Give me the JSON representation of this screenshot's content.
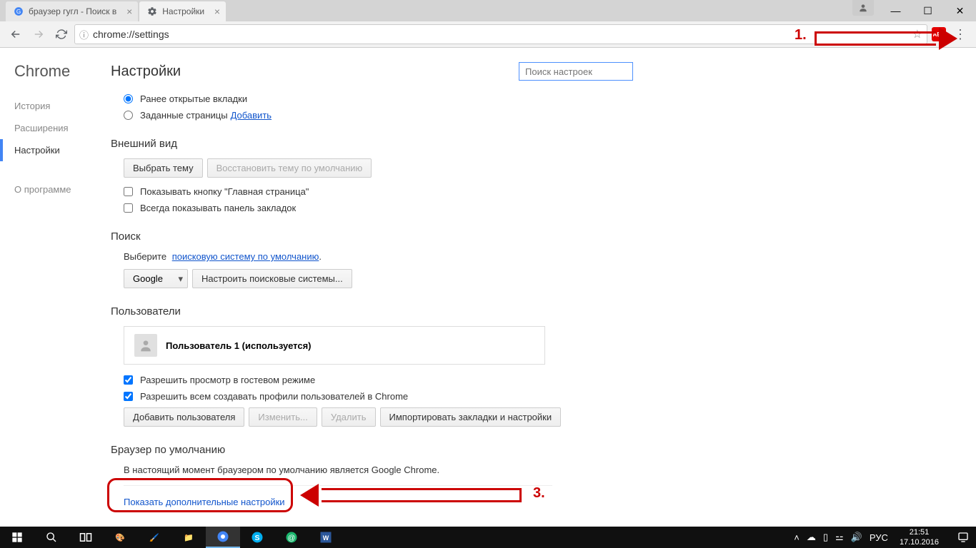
{
  "browser": {
    "tabs": [
      {
        "title": "браузер гугл - Поиск в ",
        "active": false
      },
      {
        "title": "Настройки",
        "active": true
      }
    ],
    "url": "chrome://settings",
    "ext_abp": "ABP"
  },
  "annotations": {
    "label1": "1.",
    "label3": "3."
  },
  "sidenav": {
    "logo": "Chrome",
    "history": "История",
    "extensions": "Расширения",
    "settings": "Настройки",
    "about": "О программе"
  },
  "settings": {
    "title": "Настройки",
    "search_placeholder": "Поиск настроек",
    "startup": {
      "radio_prev": "Ранее открытые вкладки",
      "radio_custom": "Заданные страницы",
      "add_link": "Добавить"
    },
    "appearance": {
      "heading": "Внешний вид",
      "choose_theme": "Выбрать тему",
      "reset_theme": "Восстановить тему по умолчанию",
      "show_home": "Показывать кнопку \"Главная страница\"",
      "show_bookmarks": "Всегда показывать панель закладок"
    },
    "search": {
      "heading": "Поиск",
      "help1": "Выберите ",
      "help_link": "поисковую систему по умолчанию",
      "engine": "Google",
      "manage": "Настроить поисковые системы..."
    },
    "users": {
      "heading": "Пользователи",
      "user1": "Пользователь 1 (используется)",
      "guest": "Разрешить просмотр в гостевом режиме",
      "anyone": "Разрешить всем создавать профили пользователей в Chrome",
      "add": "Добавить пользователя",
      "edit": "Изменить...",
      "delete": "Удалить",
      "import": "Импортировать закладки и настройки"
    },
    "default_browser": {
      "heading": "Браузер по умолчанию",
      "status": "В настоящий момент браузером по умолчанию является Google Chrome."
    },
    "advanced_link": "Показать дополнительные настройки"
  },
  "taskbar": {
    "lang": "РУС",
    "time": "21:51",
    "date": "17.10.2016"
  }
}
